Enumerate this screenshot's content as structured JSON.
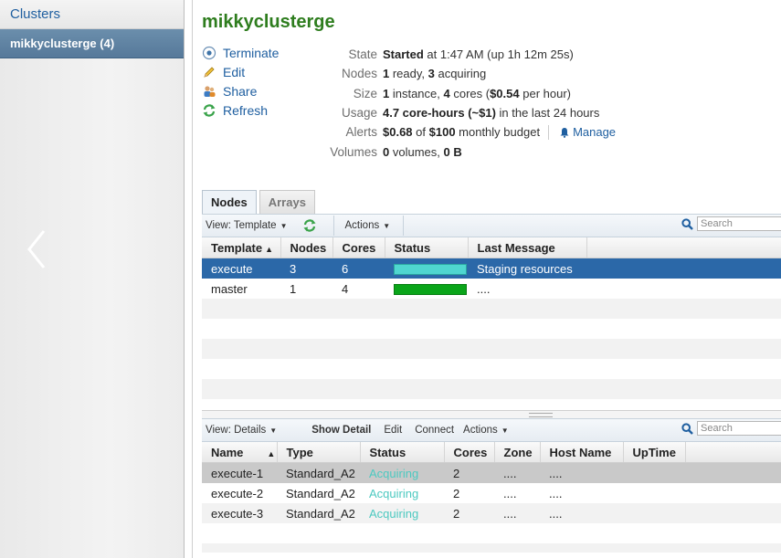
{
  "sidebar": {
    "header": "Clusters",
    "items": [
      {
        "label": "mikkyclusterge (4)"
      }
    ]
  },
  "cluster": {
    "name": "mikkyclusterge",
    "actions": [
      {
        "label": "Terminate",
        "icon": "terminate-icon"
      },
      {
        "label": "Edit",
        "icon": "pencil-icon"
      },
      {
        "label": "Share",
        "icon": "share-users-icon"
      },
      {
        "label": "Refresh",
        "icon": "refresh-icon"
      }
    ],
    "info": {
      "state": {
        "label": "State",
        "v1": "Started",
        "v2": " at 1:47 AM (up 1h 12m 25s)"
      },
      "nodes": {
        "label": "Nodes",
        "v1": "1",
        "v2": " ready, ",
        "v3": "3",
        "v4": " acquiring"
      },
      "size": {
        "label": "Size",
        "v1": "1",
        "v2": " instance, ",
        "v3": "4",
        "v4": " cores (",
        "v5": "$0.54",
        "v6": " per hour)"
      },
      "usage": {
        "label": "Usage",
        "v1": "4.7 core-hours (~$1)",
        "v2": " in the last 24 hours"
      },
      "alerts": {
        "label": "Alerts",
        "v1": "$0.68",
        "v2": " of ",
        "v3": "$100",
        "v4": " monthly budget",
        "manage": "Manage"
      },
      "volumes": {
        "label": "Volumes",
        "v1": "0",
        "v2": " volumes, ",
        "v3": "0 B"
      }
    }
  },
  "tabs": [
    {
      "label": "Nodes"
    },
    {
      "label": "Arrays"
    }
  ],
  "nodes_panel": {
    "toolbar": {
      "view": "View: Template",
      "actions": "Actions"
    },
    "search_placeholder": "Search",
    "columns": [
      "Template",
      "Nodes",
      "Cores",
      "Status",
      "Last Message"
    ],
    "rows": [
      {
        "template": "execute",
        "nodes": "3",
        "cores": "6",
        "status_color": "#4fd6d0",
        "message": "Staging resources"
      },
      {
        "template": "master",
        "nodes": "1",
        "cores": "4",
        "status_color": "#0aa51a",
        "message": "...."
      }
    ]
  },
  "details_panel": {
    "toolbar": {
      "view": "View: Details",
      "show_detail": "Show Detail",
      "edit": "Edit",
      "connect": "Connect",
      "actions": "Actions"
    },
    "search_placeholder": "Search",
    "columns": [
      "Name",
      "Type",
      "Status",
      "Cores",
      "Zone",
      "Host Name",
      "UpTime"
    ],
    "rows": [
      {
        "name": "execute-1",
        "type": "Standard_A2",
        "status": "Acquiring",
        "cores": "2",
        "zone": "....",
        "host": "...."
      },
      {
        "name": "execute-2",
        "type": "Standard_A2",
        "status": "Acquiring",
        "cores": "2",
        "zone": "....",
        "host": "...."
      },
      {
        "name": "execute-3",
        "type": "Standard_A2",
        "status": "Acquiring",
        "cores": "2",
        "zone": "....",
        "host": "...."
      }
    ]
  },
  "colors": {
    "title_green": "#2e7d1e",
    "link_blue": "#1f5fa0",
    "selected_row": "#2b68a8",
    "acquiring": "#4cc9c0"
  }
}
